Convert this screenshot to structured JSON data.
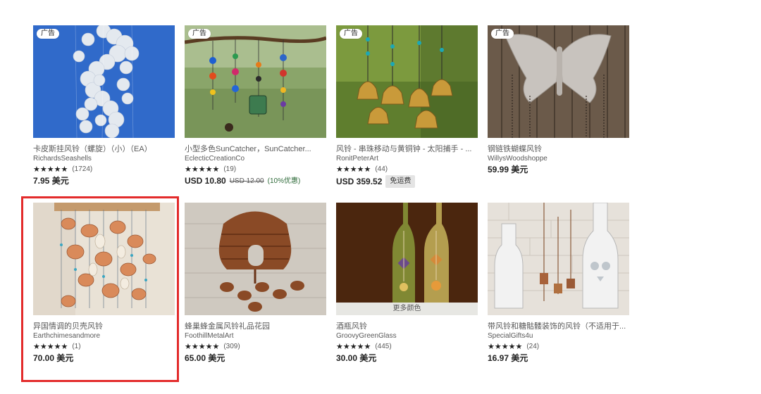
{
  "top_cutoff_text": "",
  "ad_label": "广告",
  "listings": [
    {
      "image_icon": "capiz-shell-wind-chime-photo",
      "has_ad": true,
      "title": "卡皮斯挂风铃（螺旋）（小）（EA）",
      "shop": "RichardsSeashells",
      "stars": "★★★★★",
      "count": "(1724)",
      "price": "7.95 美元",
      "original_price": "",
      "discount": "",
      "free_shipping": "",
      "more_colors": ""
    },
    {
      "image_icon": "suncatcher-beads-photo",
      "has_ad": true,
      "title": "小型多色SunCatcher，SunCatcher...",
      "shop": "EclecticCreationCo",
      "stars": "★★★★★",
      "count": "(19)",
      "price": "USD 10.80",
      "original_price": "USD 12.00",
      "discount": "(10%优惠)",
      "free_shipping": "",
      "more_colors": ""
    },
    {
      "image_icon": "brass-bells-wind-chime-photo",
      "has_ad": true,
      "title": "风铃 - 串珠移动与黄铜钟 - 太阳捕手 - ...",
      "shop": "RonitPeterArt",
      "stars": "★★★★★",
      "count": "(44)",
      "price": "USD 359.52",
      "original_price": "",
      "discount": "",
      "free_shipping": "免运费",
      "more_colors": ""
    },
    {
      "image_icon": "steel-butterfly-photo",
      "has_ad": true,
      "title": "钢链铁蝴蝶风铃",
      "shop": "WillysWoodshoppe",
      "stars": "",
      "count": "",
      "price": "59.99 美元",
      "original_price": "",
      "discount": "",
      "free_shipping": "",
      "more_colors": ""
    },
    {
      "image_icon": "seashell-wind-chime-photo",
      "has_ad": false,
      "title": "异国情调的贝壳风铃",
      "shop": "Earthchimesandmore",
      "stars": "★★★★★",
      "count": "(1)",
      "price": "70.00 美元",
      "original_price": "",
      "discount": "",
      "free_shipping": "",
      "more_colors": ""
    },
    {
      "image_icon": "metal-beehive-bees-photo",
      "has_ad": false,
      "title": "蜂巢蜂金属风铃礼品花园",
      "shop": "FoothillMetalArt",
      "stars": "★★★★★",
      "count": "(309)",
      "price": "65.00 美元",
      "original_price": "",
      "discount": "",
      "free_shipping": "",
      "more_colors": ""
    },
    {
      "image_icon": "wine-bottle-wind-chime-photo",
      "has_ad": false,
      "title": "酒瓶风铃",
      "shop": "GroovyGreenGlass",
      "stars": "★★★★★",
      "count": "(445)",
      "price": "30.00 美元",
      "original_price": "",
      "discount": "",
      "free_shipping": "",
      "more_colors": "更多颜色"
    },
    {
      "image_icon": "sugar-skull-bottle-chime-photo",
      "has_ad": false,
      "title": "带风铃和糖骷髅装饰的风铃（不适用于...",
      "shop": "SpecialGifts4u",
      "stars": "★★★★★",
      "count": "(24)",
      "price": "16.97 美元",
      "original_price": "",
      "discount": "",
      "free_shipping": "",
      "more_colors": ""
    }
  ],
  "colors": {
    "highlight": "#e32b2b",
    "discount": "#2f6b3a",
    "free_shipping_bg": "#e4e4e4"
  }
}
